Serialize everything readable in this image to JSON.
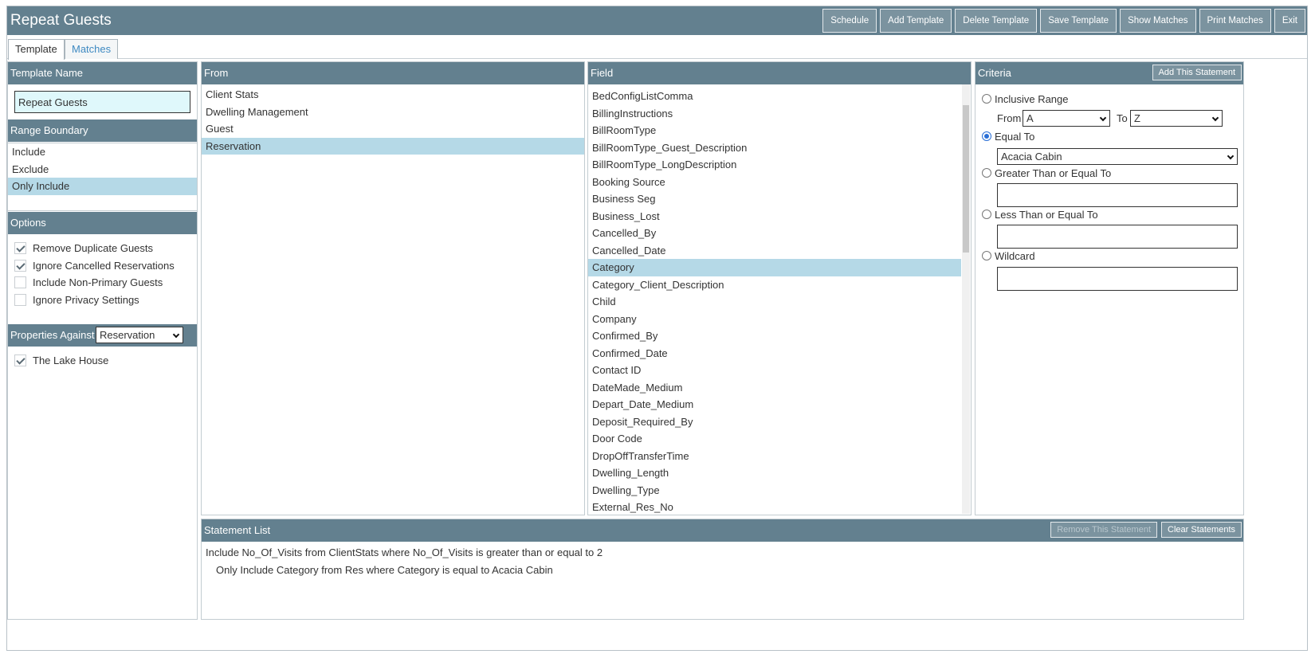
{
  "app": {
    "title": "Repeat Guests"
  },
  "toolbar": {
    "schedule": "Schedule",
    "add_template": "Add Template",
    "delete_template": "Delete Template",
    "save_template": "Save Template",
    "show_matches": "Show Matches",
    "print_matches": "Print Matches",
    "exit": "Exit"
  },
  "tabs": {
    "template": "Template",
    "matches": "Matches"
  },
  "template_name": {
    "header": "Template Name",
    "value": "Repeat Guests"
  },
  "range_boundary": {
    "header": "Range Boundary",
    "items": [
      "Include",
      "Exclude",
      "Only Include"
    ],
    "selected": "Only Include"
  },
  "options": {
    "header": "Options",
    "items": [
      {
        "label": "Remove Duplicate Guests",
        "checked": true
      },
      {
        "label": "Ignore Cancelled Reservations",
        "checked": true
      },
      {
        "label": "Include Non-Primary Guests",
        "checked": false
      },
      {
        "label": "Ignore Privacy Settings",
        "checked": false
      }
    ]
  },
  "properties": {
    "header": "Properties Against",
    "against_value": "Reservation",
    "items": [
      {
        "label": "The Lake House",
        "checked": true
      }
    ]
  },
  "from": {
    "header": "From",
    "items": [
      "Client Stats",
      "Dwelling Management",
      "Guest",
      "Reservation"
    ],
    "selected": "Reservation"
  },
  "field": {
    "header": "Field",
    "items": [
      "BedConfigListComma",
      "BillingInstructions",
      "BillRoomType",
      "BillRoomType_Guest_Description",
      "BillRoomType_LongDescription",
      "Booking Source",
      "Business Seg",
      "Business_Lost",
      "Cancelled_By",
      "Cancelled_Date",
      "Category",
      "Category_Client_Description",
      "Child",
      "Company",
      "Confirmed_By",
      "Confirmed_Date",
      "Contact ID",
      "DateMade_Medium",
      "Depart_Date_Medium",
      "Deposit_Required_By",
      "Door Code",
      "DropOffTransferTime",
      "Dwelling_Length",
      "Dwelling_Type",
      "External_Res_No"
    ],
    "selected": "Category"
  },
  "criteria": {
    "header": "Criteria",
    "add_button": "Add This Statement",
    "inclusive_range": "Inclusive Range",
    "from_label": "From",
    "from_value": "A",
    "to_label": "To",
    "to_value": "Z",
    "equal_to": "Equal To",
    "equal_value": "Acacia Cabin",
    "greater_than": "Greater Than or Equal To",
    "less_than": "Less Than or Equal To",
    "wildcard": "Wildcard",
    "selected_option": "Equal To"
  },
  "statement_list": {
    "header": "Statement List",
    "remove_button": "Remove This Statement",
    "clear_button": "Clear Statements",
    "statements": [
      "Include No_Of_Visits from ClientStats where No_Of_Visits is greater than or equal to 2",
      "Only Include Category from Res where Category is equal to Acacia Cabin"
    ]
  }
}
